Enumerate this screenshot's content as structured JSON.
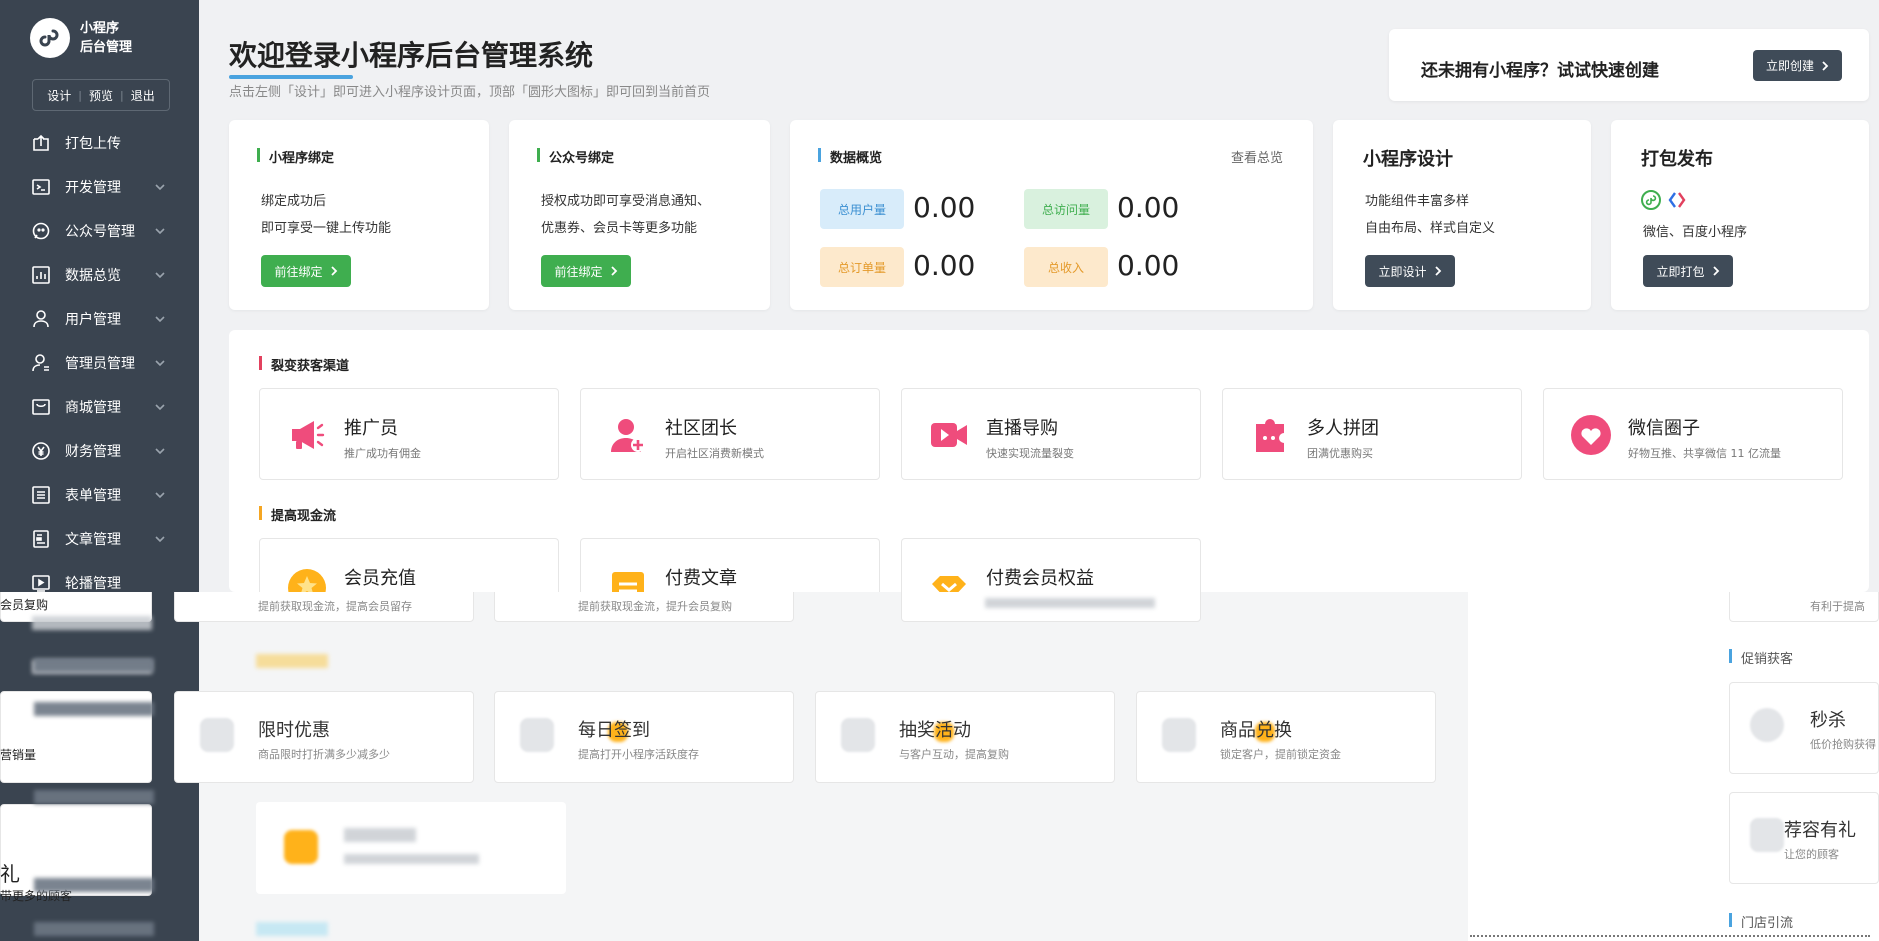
{
  "brand": {
    "line1": "小程序",
    "line2": "后台管理"
  },
  "quick_actions": [
    "设计",
    "预览",
    "退出"
  ],
  "nav": [
    {
      "label": "打包上传",
      "icon": "upload-icon",
      "chevron": false
    },
    {
      "label": "开发管理",
      "icon": "terminal-icon",
      "chevron": true
    },
    {
      "label": "公众号管理",
      "icon": "chat-icon",
      "chevron": true
    },
    {
      "label": "数据总览",
      "icon": "chart-icon",
      "chevron": true
    },
    {
      "label": "用户管理",
      "icon": "user-icon",
      "chevron": true
    },
    {
      "label": "管理员管理",
      "icon": "admin-icon",
      "chevron": true
    },
    {
      "label": "商城管理",
      "icon": "shop-icon",
      "chevron": true
    },
    {
      "label": "财务管理",
      "icon": "yen-icon",
      "chevron": true
    },
    {
      "label": "表单管理",
      "icon": "form-icon",
      "chevron": true
    },
    {
      "label": "文章管理",
      "icon": "article-icon",
      "chevron": true
    },
    {
      "label": "轮播管理",
      "icon": "carousel-icon",
      "chevron": false
    }
  ],
  "header": {
    "title": "欢迎登录小程序后台管理系统",
    "subtitle": "点击左侧「设计」即可进入小程序设计页面，顶部「圆形大图标」即可回到当前首页"
  },
  "promo": {
    "text": "还未拥有小程序？试试快速创建",
    "button": "立即创建"
  },
  "cards": {
    "mini_bind": {
      "title": "小程序绑定",
      "line1": "绑定成功后",
      "line2": "即可享受一键上传功能",
      "button": "前往绑定"
    },
    "mp_bind": {
      "title": "公众号绑定",
      "line1": "授权成功即可享受消息通知、",
      "line2": "优惠券、会员卡等更多功能",
      "button": "前往绑定"
    },
    "overview": {
      "title": "数据概览",
      "link": "查看总览",
      "stats": [
        {
          "label": "总用户量",
          "value": "0.00"
        },
        {
          "label": "总访问量",
          "value": "0.00"
        },
        {
          "label": "总订单量",
          "value": "0.00"
        },
        {
          "label": "总收入",
          "value": "0.00"
        }
      ]
    },
    "design": {
      "title": "小程序设计",
      "line1": "功能组件丰富多样",
      "line2": "自由布局、样式自定义",
      "button": "立即设计"
    },
    "publish": {
      "title": "打包发布",
      "line": "微信、百度小程序",
      "button": "立即打包"
    }
  },
  "marketing": {
    "section1": "裂变获客渠道",
    "channels": [
      {
        "title": "推广员",
        "sub": "推广成功有佣金"
      },
      {
        "title": "社区团长",
        "sub": "开启社区消费新模式"
      },
      {
        "title": "直播导购",
        "sub": "快速实现流量裂变"
      },
      {
        "title": "多人拼团",
        "sub": "团满优惠购买"
      },
      {
        "title": "微信圈子",
        "sub": "好物互推、共享微信 11 亿流量"
      }
    ],
    "section2": "提高现金流",
    "cashflow": [
      {
        "title": "会员充值"
      },
      {
        "title": "付费文章"
      },
      {
        "title": "付费会员权益"
      }
    ]
  },
  "glitch": {
    "left_text1": "会员复购",
    "left_text2": "营销量",
    "left_text3": "带更多的顾客",
    "row_subs": [
      "提前获取现金流，提高会员留存",
      "提前获取现金流，提升会员复购"
    ],
    "promos": [
      {
        "title": "限时优惠",
        "sub": "商品限时打折满多少减多少"
      },
      {
        "title": "每日签到",
        "sub": "提高打开小程序活跃度存"
      },
      {
        "title": "抽奖活动",
        "sub": "与客户互动，提高复购"
      },
      {
        "title": "商品兑换",
        "sub": "锁定客户，提前锁定资金"
      }
    ],
    "right_headers": [
      "促销获客",
      "门店引流"
    ],
    "right_items": [
      {
        "title": "秒杀",
        "sub": "低价抢购获得"
      },
      {
        "title": "荐容有礼",
        "sub": "让您的顾客"
      }
    ],
    "right_top_sub": "有利于提高"
  },
  "colors": {
    "sidebar": "#3a4450",
    "accent_green": "#3fae4f",
    "accent_blue": "#4aa3df",
    "dark_button": "#3f4b58",
    "pink_icon": "#ef4c7c"
  }
}
